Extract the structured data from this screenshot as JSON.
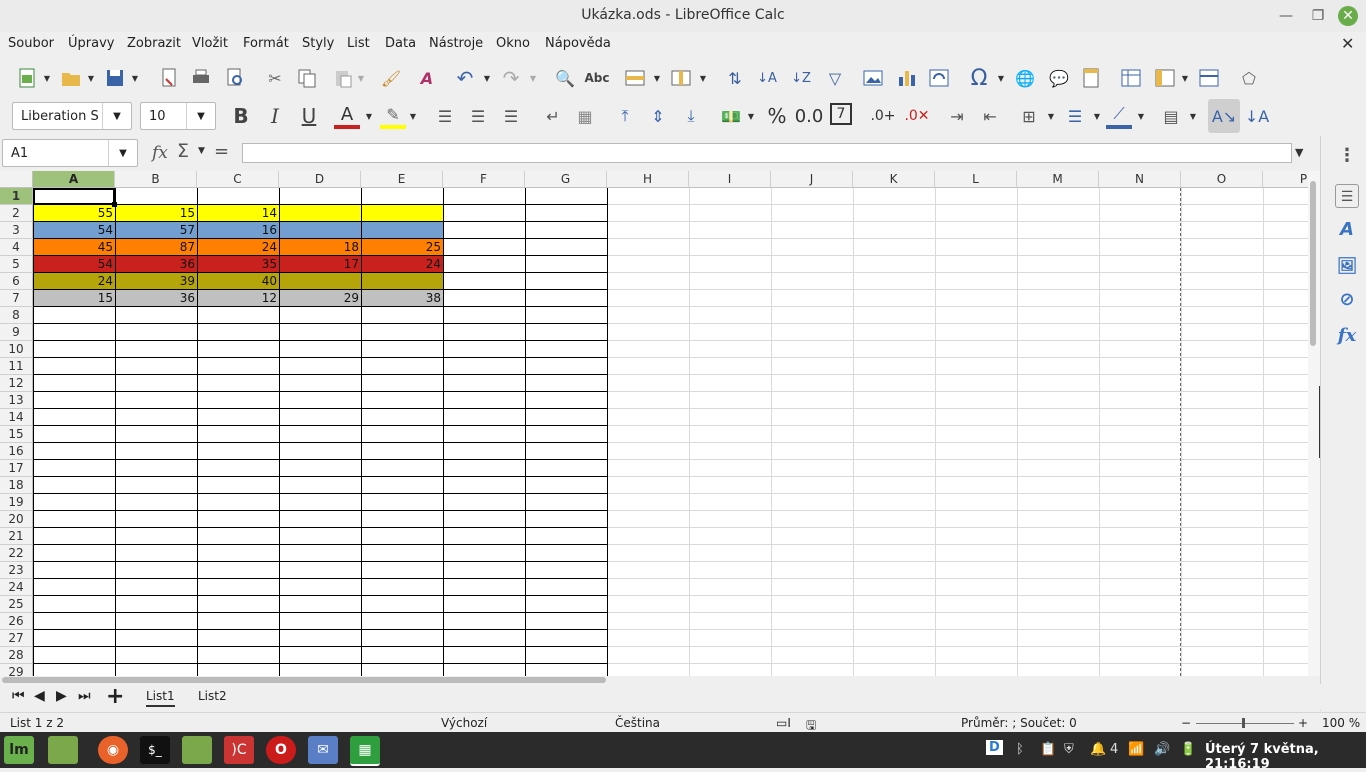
{
  "window": {
    "title": "Ukázka.ods - LibreOffice Calc"
  },
  "menu": [
    "Soubor",
    "Úpravy",
    "Zobrazit",
    "Vložit",
    "Formát",
    "Styly",
    "List",
    "Data",
    "Nástroje",
    "Okno",
    "Nápověda"
  ],
  "format": {
    "font_name": "Liberation S",
    "font_size": "10"
  },
  "formula_bar": {
    "cell_ref": "A1",
    "formula": ""
  },
  "grid": {
    "columns": [
      "A",
      "B",
      "C",
      "D",
      "E",
      "F",
      "G",
      "H",
      "I",
      "J",
      "K",
      "L",
      "M",
      "N",
      "O",
      "P"
    ],
    "rows": [
      "1",
      "2",
      "3",
      "4",
      "5",
      "6",
      "7",
      "8",
      "9",
      "10",
      "11",
      "12",
      "13",
      "14",
      "15",
      "16",
      "17",
      "18",
      "19",
      "20",
      "21",
      "22",
      "23",
      "24",
      "25",
      "26",
      "27",
      "28",
      "29"
    ],
    "data": [
      {
        "row": 2,
        "color": "#ffff00",
        "values": [
          "55",
          "15",
          "14",
          "",
          ""
        ]
      },
      {
        "row": 3,
        "color": "#729fcf",
        "values": [
          "54",
          "57",
          "16",
          "",
          ""
        ]
      },
      {
        "row": 4,
        "color": "#ff8000",
        "values": [
          "45",
          "87",
          "24",
          "18",
          "25"
        ]
      },
      {
        "row": 5,
        "color": "#c9211e",
        "values": [
          "54",
          "36",
          "35",
          "17",
          "24"
        ]
      },
      {
        "row": 6,
        "color": "#b5a50b",
        "values": [
          "24",
          "39",
          "40",
          "",
          ""
        ]
      },
      {
        "row": 7,
        "color": "#c0c0c0",
        "values": [
          "15",
          "36",
          "12",
          "29",
          "38"
        ]
      }
    ]
  },
  "sheets": [
    "List1",
    "List2"
  ],
  "status": {
    "sheet": "List 1 z 2",
    "style": "Výchozí",
    "language": "Čeština",
    "summary": "Průměr: ; Součet: 0",
    "zoom": "100 %"
  },
  "taskbar": {
    "clock": "Úterý 7 května, 21:16:19",
    "notif_count": "4"
  }
}
